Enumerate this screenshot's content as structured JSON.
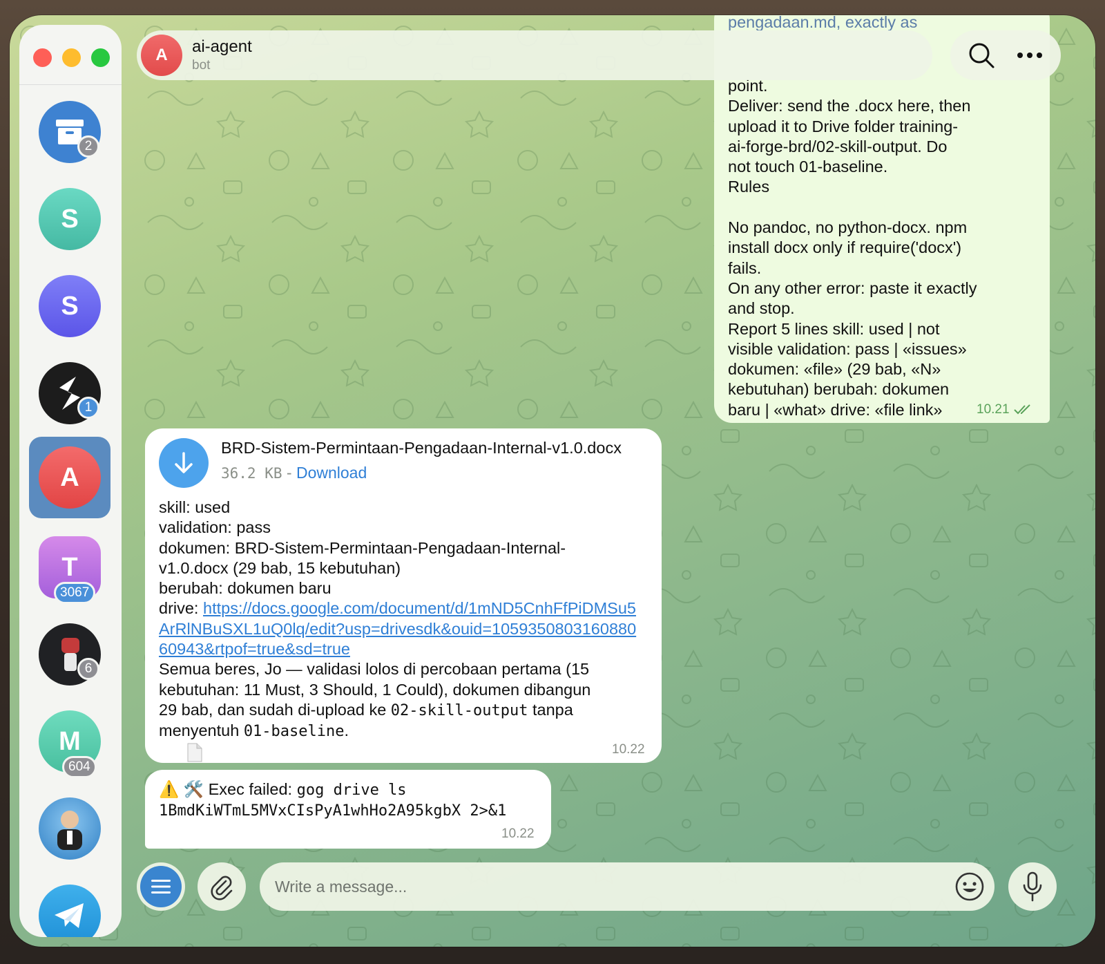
{
  "window": {
    "traffic_lights": [
      "close",
      "minimize",
      "zoom"
    ]
  },
  "sidebar": {
    "items": [
      {
        "name": "archive",
        "letter": "",
        "color": "#3e82d1",
        "badge": "2"
      },
      {
        "name": "chat-s-teal",
        "letter": "S",
        "color": "#54c7b2",
        "badge": ""
      },
      {
        "name": "chat-s-purple",
        "letter": "S",
        "color": "#6a6cf0",
        "badge": ""
      },
      {
        "name": "chat-logo-black",
        "letter": "",
        "color": "#1c1c1c",
        "badge": "1"
      },
      {
        "name": "chat-ai-agent",
        "letter": "A",
        "color": "#e75151",
        "badge": "",
        "active": true
      },
      {
        "name": "chat-t",
        "letter": "T",
        "color": "#b972e3",
        "badge": "3067"
      },
      {
        "name": "chat-fist",
        "letter": "",
        "color": "#202124",
        "badge": "6"
      },
      {
        "name": "chat-m",
        "letter": "M",
        "color": "#5ccfb0",
        "badge": "604"
      },
      {
        "name": "chat-photo",
        "letter": "",
        "color": "#3b88c9",
        "badge": ""
      },
      {
        "name": "telegram",
        "letter": "",
        "color": "#2a9be0",
        "badge": ""
      }
    ]
  },
  "header": {
    "avatar_letter": "A",
    "title": "ai-agent",
    "subtitle": "bot"
  },
  "messages": {
    "outgoing": {
      "partial_top": "pengadaan.md, exactly as",
      "text": "point.\nDeliver: send the .docx here, then\nupload it to Drive folder training-\nai-forge-brd/02-skill-output. Do\nnot touch 01-baseline.\nRules\n\nNo pandoc, no python-docx. npm\ninstall docx only if require('docx')\nfails.\nOn any other error: paste it exactly\nand stop.\nReport 5 lines skill: used | not\nvisible validation: pass | «issues»\ndokumen: «file» (29 bab, «N»\nkebutuhan) berubah: dokumen\nbaru | «what» drive: «file link»",
      "time": "10.21"
    },
    "file_message": {
      "file_name": "BRD-Sistem-Permintaan-Pengadaan-Internal-v1.0.docx",
      "file_size": "36.2 KB",
      "separator": " - ",
      "download_label": "Download",
      "text_lines_before_link": "skill: used\nvalidation: pass\ndokumen: BRD-Sistem-Permintaan-Pengadaan-Internal-\nv1.0.docx (29 bab, 15 kebutuhan)\nberubah: dokumen baru",
      "drive_label": "drive: ",
      "drive_link": "https://docs.google.com/document/d/1mND5CnhFfPiDMSu5ArRlNBuSXL1uQ0lq/edit?usp=drivesdk&ouid=105935080316088060943&rtpof=true&sd=true",
      "summary_part1": "Semua beres, Jo — validasi lolos di percobaan pertama (15\nkebutuhan: 11 Must, 3 Should, 1 Could), dokumen dibangun\n29 bab, dan sudah di-upload ke ",
      "summary_code1": "02-skill-output",
      "summary_part2": " tanpa\nmenyentuh ",
      "summary_code2": "01-baseline",
      "summary_part3": ".",
      "time": "10.22"
    },
    "error_message": {
      "icons": "⚠️ 🛠️",
      "label": "Exec failed: ",
      "command": "gog drive ls\n1BmdKiWTmL5MVxCIsPyA1whHo2A95kgbX 2>&1",
      "time": "10.22"
    }
  },
  "composer": {
    "placeholder": "Write a message..."
  }
}
